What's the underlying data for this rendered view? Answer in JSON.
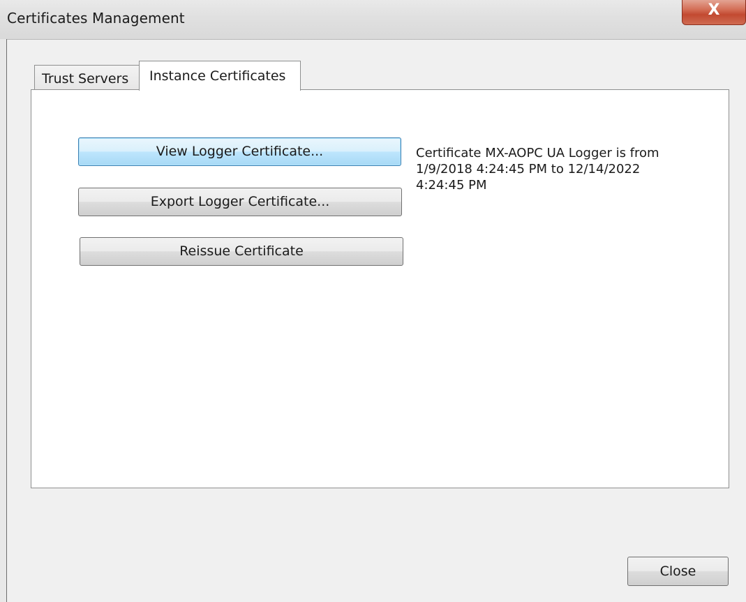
{
  "window": {
    "title": "Certificates Management",
    "close_glyph": "X"
  },
  "tabs": [
    {
      "label": "Trust Servers",
      "selected": false
    },
    {
      "label": "Instance Certificates",
      "selected": true
    }
  ],
  "buttons": {
    "view_label": "View Logger Certificate...",
    "export_label": "Export Logger Certificate...",
    "reissue_label": "Reissue Certificate",
    "close_label": "Close"
  },
  "certificate_info": {
    "line1": "Certificate MX-AOPC UA Logger is from",
    "line2": "1/9/2018 4:24:45 PM to 12/14/2022",
    "line3": "4:24:45 PM"
  }
}
